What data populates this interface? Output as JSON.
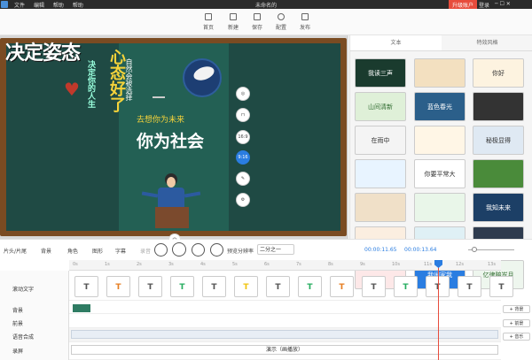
{
  "titlebar": {
    "menu": [
      "文件",
      "编辑",
      "帮助",
      "帮助"
    ],
    "title": "未命名的",
    "upgrade": "升级账户",
    "login": "登录"
  },
  "toolbar": {
    "items": [
      "首页",
      "新建",
      "保存",
      "配置",
      "发布"
    ]
  },
  "canvas": {
    "headline": "决定姿态",
    "vertical_main": "心态好了",
    "vertical_left": "决定你的人生",
    "vertical_right": "自然会被选择",
    "subtitle": "去想你为未来",
    "big_text": "你为社会"
  },
  "canvas_tools": {
    "ratio_a": "16:9",
    "ratio_b": "9:16"
  },
  "right_panel": {
    "tabs": [
      "文本",
      "特效风格"
    ],
    "thumbs": [
      "我读三声",
      "",
      "你好",
      "山间清新",
      "蓝色春光",
      "",
      "在雨中",
      "",
      "秘极显得",
      "",
      "你要平常大",
      "",
      "",
      "",
      "我知未来",
      "",
      "",
      "",
      "",
      "我闹家我",
      "亿律赔岁月",
      ""
    ]
  },
  "controls": {
    "items": [
      "片头/片尾",
      "背景",
      "角色",
      "图形",
      "字幕",
      "录音"
    ],
    "fold": "前景",
    "preset": "二分之一",
    "time_current": "00:00:11.65",
    "time_total": "00:00:13.64",
    "label_preset": "预览分辨率"
  },
  "timeline": {
    "ticks": [
      "0s",
      "1s",
      "2s",
      "3s",
      "4s",
      "5s",
      "6s",
      "7s",
      "8s",
      "9s",
      "10s",
      "11s",
      "12s",
      "13s"
    ],
    "rows": [
      "滚动文字",
      "背景",
      "前景",
      "语音合成",
      "录屏"
    ],
    "add": [
      "+ 背景",
      "+ 前景",
      "+ 音乐"
    ],
    "record_label": "演示（画播放）"
  }
}
